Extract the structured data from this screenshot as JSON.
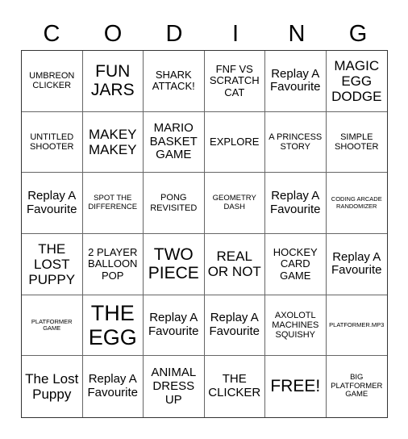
{
  "title": {
    "letters": [
      "C",
      "O",
      "D",
      "I",
      "N",
      "G"
    ]
  },
  "cells": [
    {
      "text": "UMBREON CLICKER",
      "size": "s-sm"
    },
    {
      "text": "FUN JARS",
      "size": "s-xl"
    },
    {
      "text": "SHARK ATTACK!",
      "size": "s-m"
    },
    {
      "text": "FNF VS SCRATCH CAT",
      "size": "s-m"
    },
    {
      "text": "Replay A Favourite",
      "size": "s-ml"
    },
    {
      "text": "MAGIC EGG DODGE",
      "size": "s-l"
    },
    {
      "text": "UNTITLED SHOOTER",
      "size": "s-sm"
    },
    {
      "text": "MAKEY MAKEY",
      "size": "s-l"
    },
    {
      "text": "MARIO BASKET GAME",
      "size": "s-ml"
    },
    {
      "text": "EXPLORE",
      "size": "s-m"
    },
    {
      "text": "A PRINCESS STORY",
      "size": "s-sm"
    },
    {
      "text": "SIMPLE SHOOTER",
      "size": "s-sm"
    },
    {
      "text": "Replay A Favourite",
      "size": "s-ml"
    },
    {
      "text": "SPOT THE DIFFERENCE",
      "size": "s-s"
    },
    {
      "text": "PONG REVISITED",
      "size": "s-sm"
    },
    {
      "text": "GEOMETRY DASH",
      "size": "s-s"
    },
    {
      "text": "Replay A Favourite",
      "size": "s-ml"
    },
    {
      "text": "CODING ARCADE RANDOMIZER",
      "size": "s-xs"
    },
    {
      "text": "THE LOST PUPPY",
      "size": "s-l"
    },
    {
      "text": "2 PLAYER BALLOON POP",
      "size": "s-m"
    },
    {
      "text": "TWO PIECE",
      "size": "s-xl"
    },
    {
      "text": "REAL OR NOT",
      "size": "s-l"
    },
    {
      "text": "HOCKEY CARD GAME",
      "size": "s-m"
    },
    {
      "text": "Replay A Favourite",
      "size": "s-ml"
    },
    {
      "text": "PLATFORMER GAME",
      "size": "s-xs"
    },
    {
      "text": "THE EGG",
      "size": "s-xxl"
    },
    {
      "text": "Replay A Favourite",
      "size": "s-ml"
    },
    {
      "text": "Replay A Favourite",
      "size": "s-ml"
    },
    {
      "text": "AXOLOTL MACHINES SQUISHY",
      "size": "s-sm"
    },
    {
      "text": "PLATFORMER.MP3",
      "size": "s-xs"
    },
    {
      "text": "The Lost Puppy",
      "size": "s-l"
    },
    {
      "text": "Replay A Favourite",
      "size": "s-ml"
    },
    {
      "text": "ANIMAL DRESS UP",
      "size": "s-ml"
    },
    {
      "text": "THE CLICKER",
      "size": "s-ml"
    },
    {
      "text": "FREE!",
      "size": "s-xl"
    },
    {
      "text": "BIG PLATFORMER GAME",
      "size": "s-s"
    }
  ]
}
